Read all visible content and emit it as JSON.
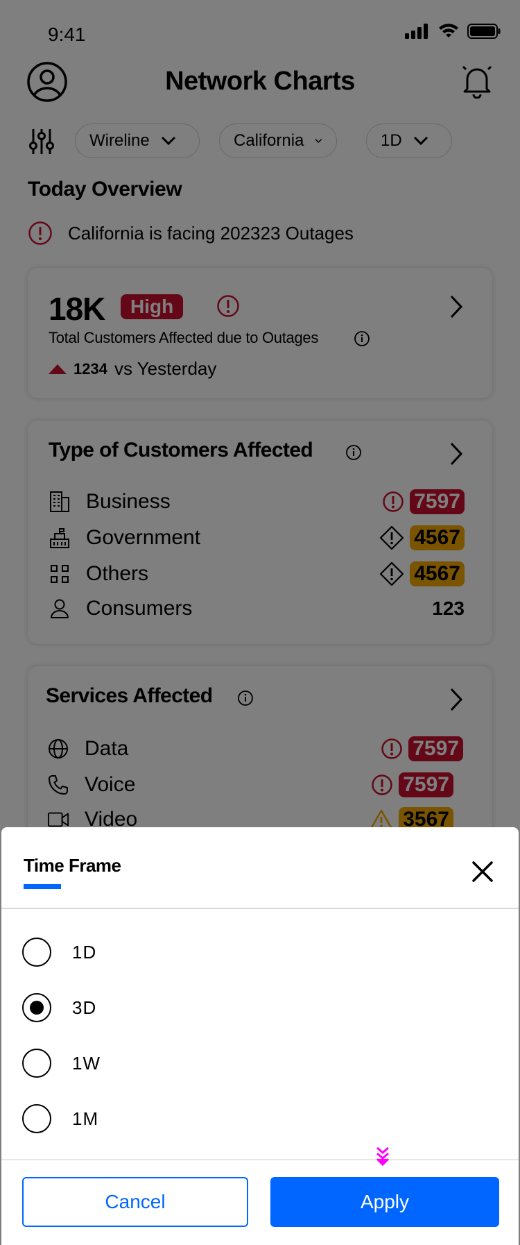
{
  "status_bar": {
    "time": "9:41"
  },
  "header": {
    "title": "Network Charts"
  },
  "filters": {
    "chips": [
      {
        "label": "Wireline"
      },
      {
        "label": "California"
      },
      {
        "label": "1D"
      }
    ]
  },
  "overview": {
    "title": "Today Overview",
    "alert": "California is facing 202323 Outages"
  },
  "total_card": {
    "value": "18K",
    "severity": "High",
    "description": "Total Customers Affected due to Outages",
    "delta_value": "1234",
    "delta_text": "vs Yesterday"
  },
  "customers_card": {
    "title": "Type of Customers Affected",
    "rows": [
      {
        "label": "Business",
        "value": "7597",
        "icon": "building-icon",
        "status": "critical"
      },
      {
        "label": "Government",
        "value": "4567",
        "icon": "government-icon",
        "status": "warning"
      },
      {
        "label": "Others",
        "value": "4567",
        "icon": "grid-icon",
        "status": "warning"
      },
      {
        "label": "Consumers",
        "value": "123",
        "icon": "person-icon",
        "status": "normal"
      }
    ]
  },
  "services_card": {
    "title": "Services Affected",
    "rows": [
      {
        "label": "Data",
        "value": "7597",
        "icon": "globe-icon",
        "status": "critical"
      },
      {
        "label": "Voice",
        "value": "7597",
        "icon": "phone-icon",
        "status": "critical"
      },
      {
        "label": "Video",
        "value": "3567",
        "icon": "video-icon",
        "status": "warning"
      }
    ]
  },
  "sheet": {
    "tab_label": "Time Frame",
    "options": [
      {
        "label": "1D",
        "selected": false
      },
      {
        "label": "3D",
        "selected": true
      },
      {
        "label": "1W",
        "selected": false
      },
      {
        "label": "1M",
        "selected": false
      }
    ],
    "cancel_label": "Cancel",
    "apply_label": "Apply"
  },
  "colors": {
    "accent": "#0066ff",
    "critical": "#c8102e",
    "warning": "#f5a800"
  }
}
